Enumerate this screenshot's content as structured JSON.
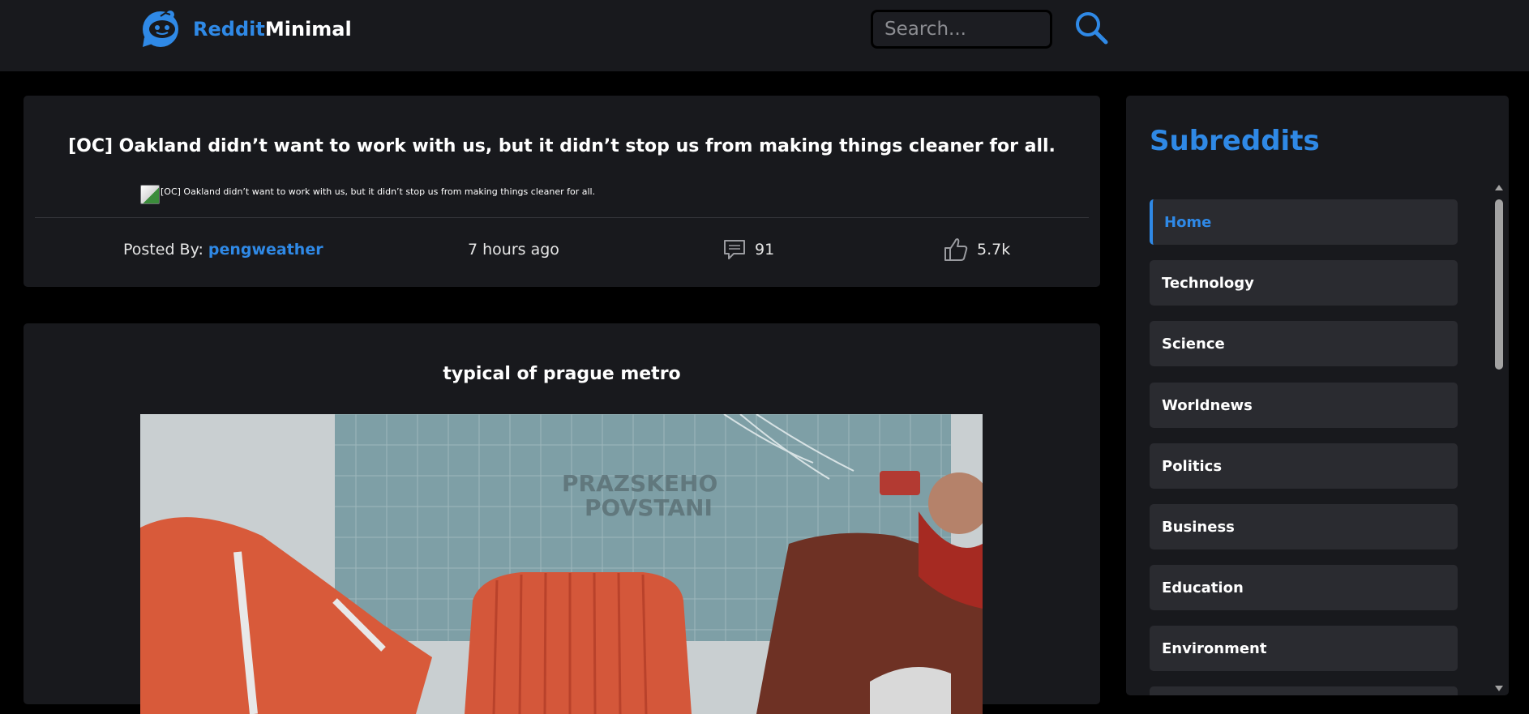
{
  "header": {
    "logo_part1": "Reddit",
    "logo_part2": "Minimal",
    "search_placeholder": "Search...",
    "accent_color": "#2f89e6"
  },
  "posts": [
    {
      "title": "[OC] Oakland didn’t want to work with us, but it didn’t stop us from making things cleaner for all.",
      "image_alt": "[OC] Oakland didn’t want to work with us, but it didn’t stop us from making things cleaner for all.",
      "posted_by_label": "Posted By:",
      "author": "pengweather",
      "time": "7 hours ago",
      "comments": "91",
      "likes": "5.7k"
    },
    {
      "title": "typical of prague metro"
    }
  ],
  "sidebar": {
    "title": "Subreddits",
    "items": [
      {
        "label": "Home",
        "active": true
      },
      {
        "label": "Technology"
      },
      {
        "label": "Science"
      },
      {
        "label": "Worldnews"
      },
      {
        "label": "Politics"
      },
      {
        "label": "Business"
      },
      {
        "label": "Education"
      },
      {
        "label": "Environment"
      }
    ]
  },
  "icons": {
    "logo": "reddit-alien-icon",
    "search": "search-icon",
    "comments": "comment-icon",
    "likes": "thumbs-up-icon"
  }
}
